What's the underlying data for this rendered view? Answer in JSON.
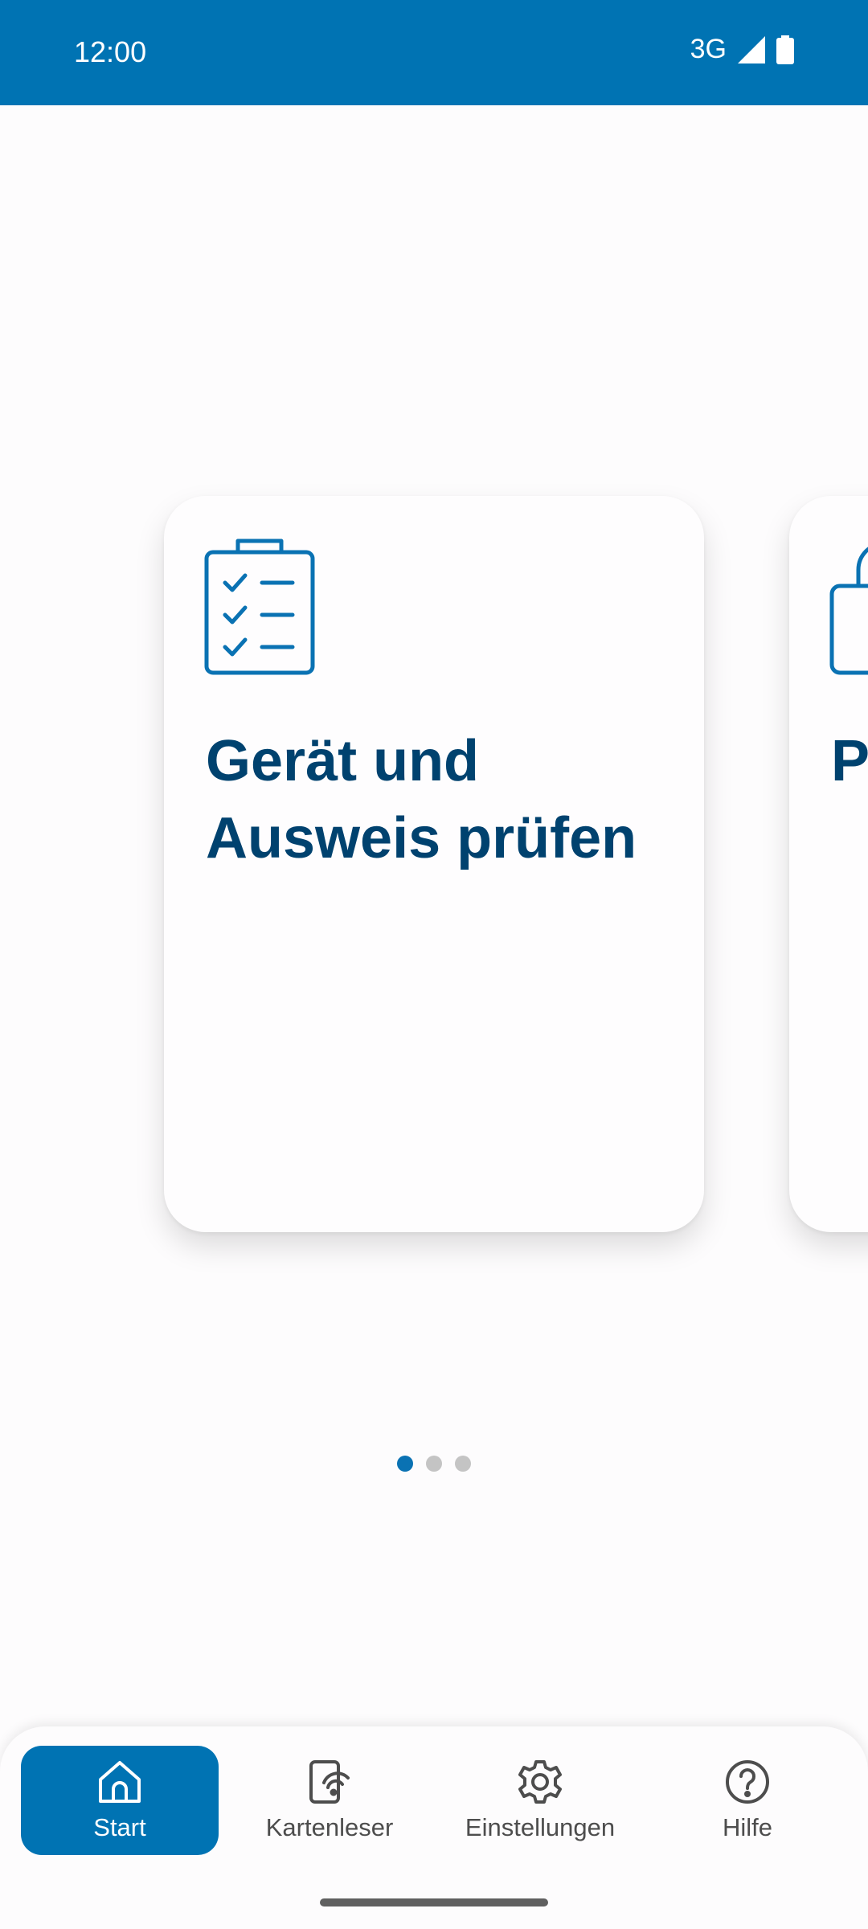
{
  "status_bar": {
    "time": "12:00",
    "network": "3G",
    "color": "#0073b3"
  },
  "carousel": {
    "cards": [
      {
        "icon": "clipboard-checklist-icon",
        "title": "Gerät und Ausweis prüfen"
      },
      {
        "icon": "padlock-icon",
        "title": "P"
      }
    ],
    "page_count": 3,
    "active_page": 0
  },
  "bottom_nav": {
    "items": [
      {
        "label": "Start",
        "icon": "home-icon",
        "selected": true
      },
      {
        "label": "Kartenleser",
        "icon": "card-reader-icon",
        "selected": false
      },
      {
        "label": "Einstellungen",
        "icon": "gear-icon",
        "selected": false
      },
      {
        "label": "Hilfe",
        "icon": "help-circle-icon",
        "selected": false
      }
    ]
  },
  "colors": {
    "primary": "#0073b3",
    "card_title": "#00426f"
  }
}
